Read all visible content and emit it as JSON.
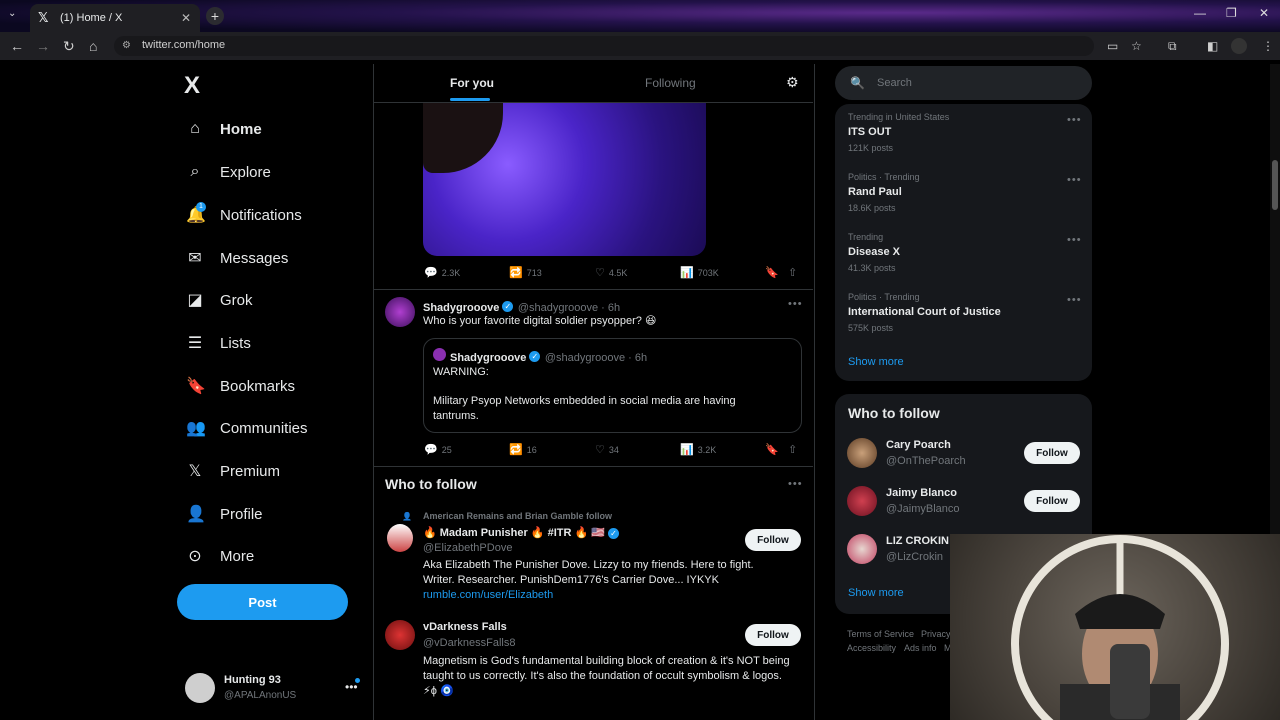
{
  "browser": {
    "tab_title": "(1) Home / X",
    "url": "twitter.com/home",
    "new_tab": "+",
    "close_tab": "✕"
  },
  "nav": {
    "logo": "X",
    "items": [
      {
        "label": "Home",
        "icon": "home-icon",
        "active": true
      },
      {
        "label": "Explore",
        "icon": "search-icon"
      },
      {
        "label": "Notifications",
        "icon": "bell-icon",
        "badge": "1"
      },
      {
        "label": "Messages",
        "icon": "mail-icon"
      },
      {
        "label": "Grok",
        "icon": "grok-icon"
      },
      {
        "label": "Lists",
        "icon": "list-icon"
      },
      {
        "label": "Bookmarks",
        "icon": "bookmark-icon"
      },
      {
        "label": "Communities",
        "icon": "communities-icon"
      },
      {
        "label": "Premium",
        "icon": "x-icon"
      },
      {
        "label": "Profile",
        "icon": "profile-icon"
      },
      {
        "label": "More",
        "icon": "more-icon"
      }
    ],
    "post_label": "Post",
    "account": {
      "name": "Hunting 93",
      "handle": "@APALAnonUS"
    }
  },
  "feed": {
    "tabs": {
      "for_you": "For you",
      "following": "Following"
    },
    "tweet1_actions": {
      "replies": "2.3K",
      "retweets": "713",
      "likes": "4.5K",
      "views": "703K"
    },
    "tweet2": {
      "name": "Shadygrooove",
      "handle": "@shadygrooove · 6h",
      "text": "Who is your favorite digital soldier psyopper? 😆",
      "quote": {
        "name": "Shadygrooove",
        "handle": "@shadygrooove · 6h",
        "line1": "WARNING:",
        "line2": "Military Psyop Networks embedded in social media are having tantrums."
      },
      "actions": {
        "replies": "25",
        "retweets": "16",
        "likes": "34",
        "views": "3.2K"
      }
    },
    "who_to_follow": {
      "title": "Who to follow",
      "suggestions": [
        {
          "context": "American Remains and Brian Gamble follow",
          "name": "🔥 Madam Punisher 🔥 #ITR 🔥 🇺🇸",
          "handle": "@ElizabethPDove",
          "bio": "Aka Elizabeth The Punisher Dove. Lizzy to my friends. Here to fight. Writer. Researcher. PunishDem1776's Carrier Dove... IYKYK",
          "link": "rumble.com/user/Elizabeth",
          "button": "Follow"
        },
        {
          "name": "vDarkness Falls",
          "handle": "@vDarknessFalls8",
          "bio": "Magnetism is God's fundamental building block of creation & it's NOT being taught to us correctly. It's also the foundation of occult symbolism & logos. ⚡ϕ 🧿",
          "button": "Follow"
        }
      ]
    }
  },
  "right": {
    "search_placeholder": "Search",
    "trends": [
      {
        "context": "Trending in United States",
        "name": "ITS OUT",
        "count": "121K posts"
      },
      {
        "context": "Politics · Trending",
        "name": "Rand Paul",
        "count": "18.6K posts"
      },
      {
        "context": "Trending",
        "name": "Disease X",
        "count": "41.3K posts"
      },
      {
        "context": "Politics · Trending",
        "name": "International Court of Justice",
        "count": "575K posts"
      }
    ],
    "show_more": "Show more",
    "who_to_follow": {
      "title": "Who to follow",
      "users": [
        {
          "name": "Cary Poarch",
          "handle": "@OnThePoarch",
          "button": "Follow"
        },
        {
          "name": "Jaimy Blanco",
          "handle": "@JaimyBlanco",
          "button": "Follow"
        },
        {
          "name": "LIZ CROKIN",
          "handle": "@LizCrokin"
        }
      ],
      "show_more": "Show more"
    },
    "footer": {
      "terms": "Terms of Service",
      "privacy": "Privacy",
      "accessibility": "Accessibility",
      "ads": "Ads info",
      "more": "M"
    }
  },
  "colors": {
    "accent": "#1d9bf0",
    "background": "#000000",
    "border": "#2f3336",
    "muted": "#71767b"
  }
}
